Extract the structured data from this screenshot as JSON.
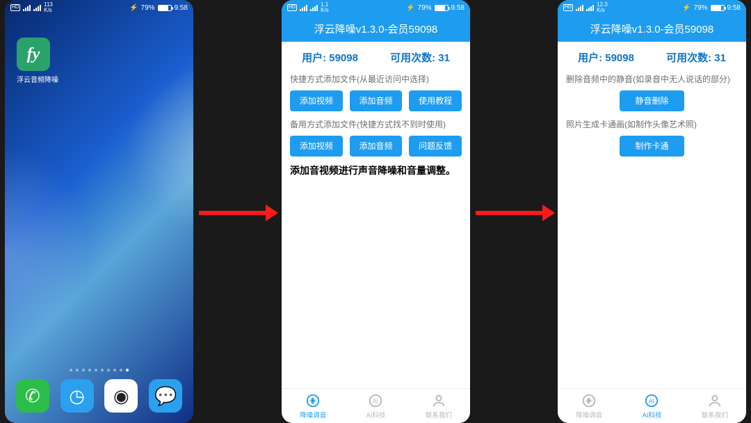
{
  "status": {
    "net_top": "1.1",
    "net_top_p1": "113",
    "net_top_p3": "12.3",
    "net_unit": "K/s",
    "battery_pct": "79%",
    "time": "9:58",
    "hd": "HD"
  },
  "home": {
    "app_icon_text": "fy",
    "app_label": "浮云音频降噪"
  },
  "app": {
    "title": "浮云降噪v1.3.0-会员59098",
    "user_label": "用户: 59098",
    "quota_label": "可用次数: 31",
    "tabs": {
      "noise": "降噪调音",
      "ai": "AI科技",
      "contact": "联系我们"
    }
  },
  "screen2": {
    "hint1": "快捷方式添加文件(从最近访问中选择)",
    "row1": {
      "b1": "添加视频",
      "b2": "添加音频",
      "b3": "使用教程"
    },
    "hint2": "备用方式添加文件(快捷方式找不到时使用)",
    "row2": {
      "b1": "添加视频",
      "b2": "添加音频",
      "b3": "问题反馈"
    },
    "lead": "添加音视频进行声音降噪和音量调整。"
  },
  "screen3": {
    "hint1": "删除音频中的静音(如录音中无人说话的部分)",
    "btn1": "静音删除",
    "hint2": "照片生成卡通画(如制作头像艺术照)",
    "btn2": "制作卡通"
  }
}
